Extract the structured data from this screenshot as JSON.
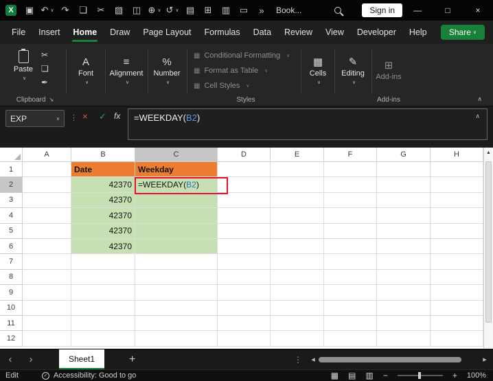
{
  "ui": {
    "chevron_down": "∨",
    "chevron_up": "∧",
    "dots_vertical": "⋮",
    "dialog_launcher": "↘"
  },
  "titlebar": {
    "icons": [
      {
        "name": "excel-logo",
        "glyph": "X"
      },
      {
        "name": "save",
        "glyph": "▣"
      },
      {
        "name": "undo",
        "glyph": "↶"
      },
      {
        "name": "redo",
        "glyph": "↷"
      },
      {
        "name": "copy",
        "glyph": "❏"
      },
      {
        "name": "cut",
        "glyph": "✂"
      },
      {
        "name": "picture",
        "glyph": "▨"
      },
      {
        "name": "chart",
        "glyph": "◫"
      },
      {
        "name": "link",
        "glyph": "⊕"
      },
      {
        "name": "undo-history",
        "glyph": "↺"
      },
      {
        "name": "print",
        "glyph": "▤"
      },
      {
        "name": "borders",
        "glyph": "⊞"
      },
      {
        "name": "camera",
        "glyph": "▥"
      },
      {
        "name": "keyboard",
        "glyph": "▭"
      },
      {
        "name": "overflow",
        "glyph": "»"
      }
    ],
    "workbook_name": "Book...",
    "sign_in_label": "Sign in",
    "minimize_glyph": "—",
    "maximize_glyph": "□",
    "close_glyph": "×"
  },
  "menu": {
    "tabs": [
      {
        "label": "File"
      },
      {
        "label": "Insert"
      },
      {
        "label": "Home"
      },
      {
        "label": "Draw"
      },
      {
        "label": "Page Layout"
      },
      {
        "label": "Formulas"
      },
      {
        "label": "Data"
      },
      {
        "label": "Review"
      },
      {
        "label": "View"
      },
      {
        "label": "Developer"
      },
      {
        "label": "Help"
      }
    ],
    "active_tab": "Home",
    "share_label": "Share"
  },
  "ribbon": {
    "paste": "Paste",
    "cut_glyph": "✂",
    "copy_glyph": "❏",
    "format_painter_glyph": "✒",
    "font": "Font",
    "font_glyph": "A",
    "alignment": "Alignment",
    "alignment_glyph": "≡",
    "number": "Number",
    "number_glyph": "%",
    "styles_icon_glyph": "▦",
    "styles_items": [
      {
        "label": "Conditional Formatting"
      },
      {
        "label": "Format as Table"
      },
      {
        "label": "Cell Styles"
      }
    ],
    "styles_group": "Styles",
    "cells": "Cells",
    "cells_glyph": "▦",
    "editing": "Editing",
    "editing_glyph": "✎",
    "addins": "Add-ins",
    "addins_glyph": "⊞",
    "addins_group": "Add-ins",
    "clipboard_group": "Clipboard"
  },
  "formula_bar": {
    "name_box": "EXP",
    "cancel_glyph": "×",
    "enter_glyph": "✓",
    "fx": "fx",
    "prefix": "=WEEKDAY(",
    "ref": "B2",
    "suffix": ")"
  },
  "grid": {
    "columns": [
      "A",
      "B",
      "C",
      "D",
      "E",
      "F",
      "G",
      "H"
    ],
    "rows": [
      "1",
      "2",
      "3",
      "4",
      "5",
      "6",
      "7",
      "8",
      "9",
      "10",
      "11",
      "12"
    ],
    "selected_column": "C",
    "selected_row": "2",
    "vscroll_up_glyph": "▲",
    "cells": [
      {
        "ref": "B1",
        "text": "Date",
        "style": "hdr"
      },
      {
        "ref": "C1",
        "text": "Weekday",
        "style": "hdr"
      },
      {
        "ref": "B2",
        "text": "42370",
        "style": "num"
      },
      {
        "ref": "B3",
        "text": "42370",
        "style": "num"
      },
      {
        "ref": "B4",
        "text": "42370",
        "style": "num"
      },
      {
        "ref": "B5",
        "text": "42370",
        "style": "num"
      },
      {
        "ref": "B6",
        "text": "42370",
        "style": "num"
      },
      {
        "ref": "C2",
        "style": "edit",
        "parts": [
          {
            "text": "=WEEKDAY(",
            "type": "plain"
          },
          {
            "text": "B2",
            "type": "ref"
          },
          {
            "text": ")",
            "type": "plain"
          }
        ]
      },
      {
        "ref": "C3",
        "style": "fill"
      },
      {
        "ref": "C4",
        "style": "fill"
      },
      {
        "ref": "C5",
        "style": "fill"
      },
      {
        "ref": "C6",
        "style": "fill"
      }
    ]
  },
  "sheetbar": {
    "nav_left_glyph": "‹",
    "nav_right_glyph": "›",
    "active_tab": "Sheet1",
    "add_glyph": "+",
    "options_glyph": "⋮",
    "scroll_left_glyph": "◂",
    "scroll_right_glyph": "▸"
  },
  "statusbar": {
    "mode": "Edit",
    "accessibility_glyph": "✓",
    "accessibility": "Accessibility: Good to go",
    "normal_view_glyph": "▦",
    "page_layout_glyph": "▤",
    "page_break_glyph": "▥",
    "zoom_out_glyph": "−",
    "zoom_in_glyph": "+",
    "zoom_level": "100%"
  },
  "colors": {
    "excel_green": "#107C41",
    "share_green": "#188038",
    "header_orange": "#ED7D31",
    "cell_green": "#C6E0B4",
    "reference_blue": "#2E75B6",
    "annotation_red": "#E81123"
  }
}
